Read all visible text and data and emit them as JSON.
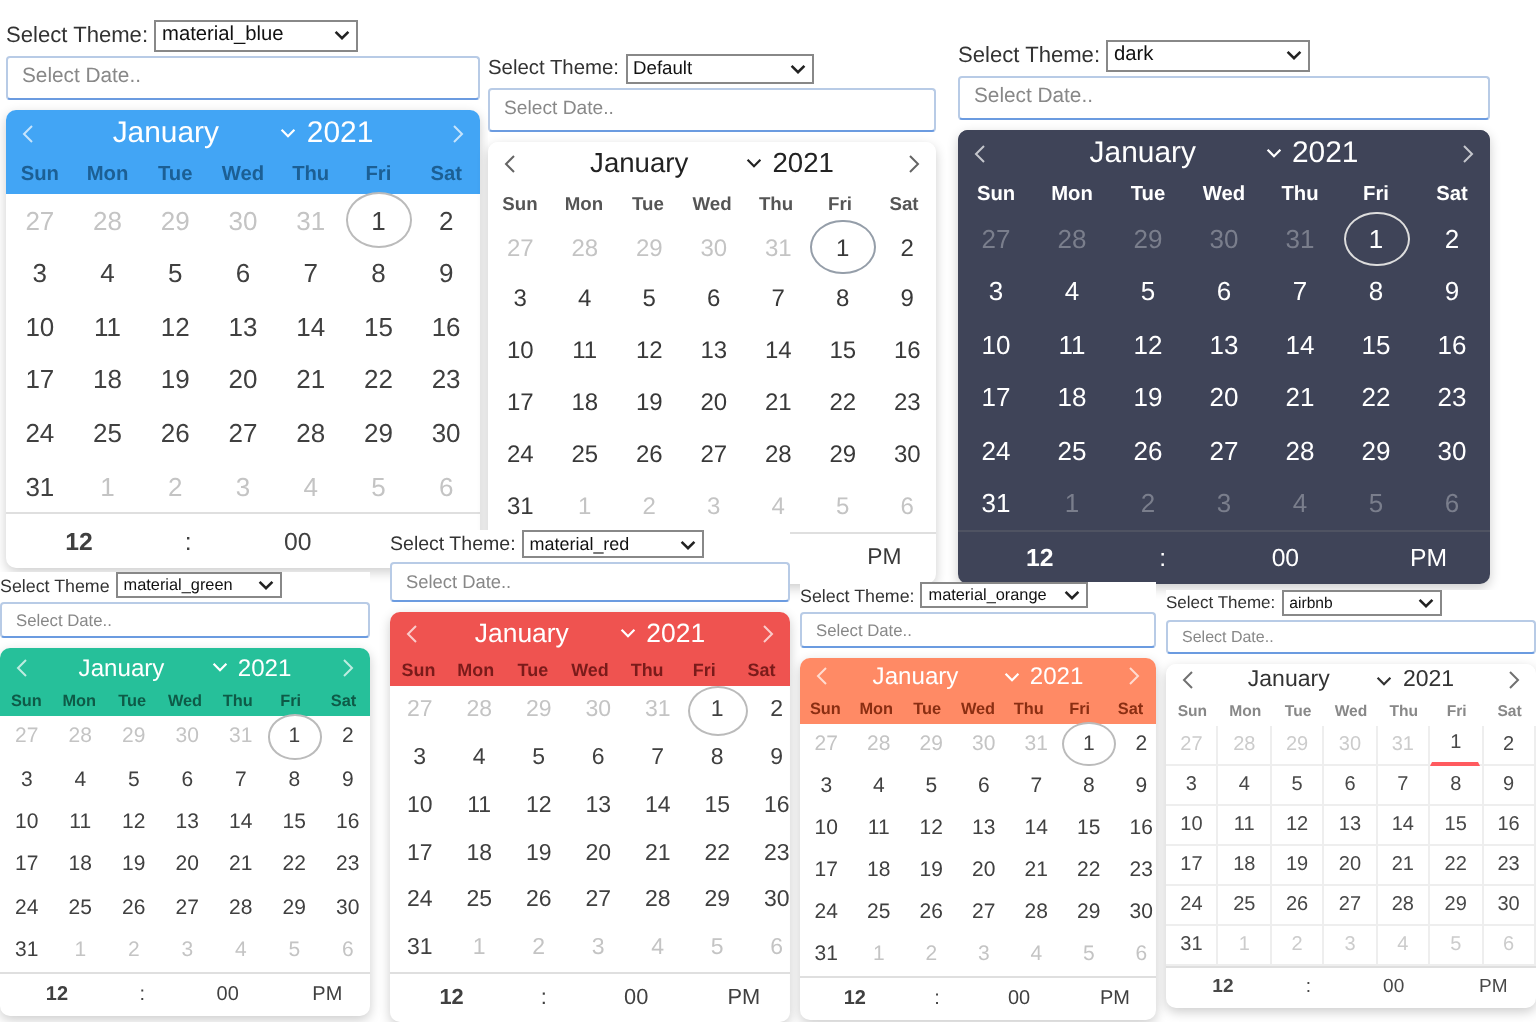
{
  "panels": [
    {
      "kind": "material_blue",
      "label": "Select Theme:",
      "theme": "material_blue",
      "placeholder": "Select Date..",
      "month": "January",
      "year": "2021",
      "weekdays": [
        "Sun",
        "Mon",
        "Tue",
        "Wed",
        "Thu",
        "Fri",
        "Sat"
      ],
      "days": [
        {
          "n": "27",
          "outside": true,
          "today": false
        },
        {
          "n": "28",
          "outside": true,
          "today": false
        },
        {
          "n": "29",
          "outside": true,
          "today": false
        },
        {
          "n": "30",
          "outside": true,
          "today": false
        },
        {
          "n": "31",
          "outside": true,
          "today": false
        },
        {
          "n": "1",
          "outside": false,
          "today": true
        },
        {
          "n": "2",
          "outside": false,
          "today": false
        },
        {
          "n": "3",
          "outside": false,
          "today": false
        },
        {
          "n": "4",
          "outside": false,
          "today": false
        },
        {
          "n": "5",
          "outside": false,
          "today": false
        },
        {
          "n": "6",
          "outside": false,
          "today": false
        },
        {
          "n": "7",
          "outside": false,
          "today": false
        },
        {
          "n": "8",
          "outside": false,
          "today": false
        },
        {
          "n": "9",
          "outside": false,
          "today": false
        },
        {
          "n": "10",
          "outside": false,
          "today": false
        },
        {
          "n": "11",
          "outside": false,
          "today": false
        },
        {
          "n": "12",
          "outside": false,
          "today": false
        },
        {
          "n": "13",
          "outside": false,
          "today": false
        },
        {
          "n": "14",
          "outside": false,
          "today": false
        },
        {
          "n": "15",
          "outside": false,
          "today": false
        },
        {
          "n": "16",
          "outside": false,
          "today": false
        },
        {
          "n": "17",
          "outside": false,
          "today": false
        },
        {
          "n": "18",
          "outside": false,
          "today": false
        },
        {
          "n": "19",
          "outside": false,
          "today": false
        },
        {
          "n": "20",
          "outside": false,
          "today": false
        },
        {
          "n": "21",
          "outside": false,
          "today": false
        },
        {
          "n": "22",
          "outside": false,
          "today": false
        },
        {
          "n": "23",
          "outside": false,
          "today": false
        },
        {
          "n": "24",
          "outside": false,
          "today": false
        },
        {
          "n": "25",
          "outside": false,
          "today": false
        },
        {
          "n": "26",
          "outside": false,
          "today": false
        },
        {
          "n": "27",
          "outside": false,
          "today": false
        },
        {
          "n": "28",
          "outside": false,
          "today": false
        },
        {
          "n": "29",
          "outside": false,
          "today": false
        },
        {
          "n": "30",
          "outside": false,
          "today": false
        },
        {
          "n": "31",
          "outside": false,
          "today": false
        },
        {
          "n": "1",
          "outside": true,
          "today": false
        },
        {
          "n": "2",
          "outside": true,
          "today": false
        },
        {
          "n": "3",
          "outside": true,
          "today": false
        },
        {
          "n": "4",
          "outside": true,
          "today": false
        },
        {
          "n": "5",
          "outside": true,
          "today": false
        },
        {
          "n": "6",
          "outside": true,
          "today": false
        }
      ],
      "time": {
        "hour": "12",
        "separator": ":",
        "minute": "00"
      }
    },
    {
      "kind": "default",
      "label": "Select Theme:",
      "theme": "Default",
      "placeholder": "Select Date..",
      "month": "January",
      "year": "2021",
      "weekdays": [
        "Sun",
        "Mon",
        "Tue",
        "Wed",
        "Thu",
        "Fri",
        "Sat"
      ],
      "days": [
        {
          "n": "27",
          "outside": true,
          "today": false
        },
        {
          "n": "28",
          "outside": true,
          "today": false
        },
        {
          "n": "29",
          "outside": true,
          "today": false
        },
        {
          "n": "30",
          "outside": true,
          "today": false
        },
        {
          "n": "31",
          "outside": true,
          "today": false
        },
        {
          "n": "1",
          "outside": false,
          "today": true
        },
        {
          "n": "2",
          "outside": false,
          "today": false
        },
        {
          "n": "3",
          "outside": false,
          "today": false
        },
        {
          "n": "4",
          "outside": false,
          "today": false
        },
        {
          "n": "5",
          "outside": false,
          "today": false
        },
        {
          "n": "6",
          "outside": false,
          "today": false
        },
        {
          "n": "7",
          "outside": false,
          "today": false
        },
        {
          "n": "8",
          "outside": false,
          "today": false
        },
        {
          "n": "9",
          "outside": false,
          "today": false
        },
        {
          "n": "10",
          "outside": false,
          "today": false
        },
        {
          "n": "11",
          "outside": false,
          "today": false
        },
        {
          "n": "12",
          "outside": false,
          "today": false
        },
        {
          "n": "13",
          "outside": false,
          "today": false
        },
        {
          "n": "14",
          "outside": false,
          "today": false
        },
        {
          "n": "15",
          "outside": false,
          "today": false
        },
        {
          "n": "16",
          "outside": false,
          "today": false
        },
        {
          "n": "17",
          "outside": false,
          "today": false
        },
        {
          "n": "18",
          "outside": false,
          "today": false
        },
        {
          "n": "19",
          "outside": false,
          "today": false
        },
        {
          "n": "20",
          "outside": false,
          "today": false
        },
        {
          "n": "21",
          "outside": false,
          "today": false
        },
        {
          "n": "22",
          "outside": false,
          "today": false
        },
        {
          "n": "23",
          "outside": false,
          "today": false
        },
        {
          "n": "24",
          "outside": false,
          "today": false
        },
        {
          "n": "25",
          "outside": false,
          "today": false
        },
        {
          "n": "26",
          "outside": false,
          "today": false
        },
        {
          "n": "27",
          "outside": false,
          "today": false
        },
        {
          "n": "28",
          "outside": false,
          "today": false
        },
        {
          "n": "29",
          "outside": false,
          "today": false
        },
        {
          "n": "30",
          "outside": false,
          "today": false
        },
        {
          "n": "31",
          "outside": false,
          "today": false
        },
        {
          "n": "1",
          "outside": true,
          "today": false
        },
        {
          "n": "2",
          "outside": true,
          "today": false
        },
        {
          "n": "3",
          "outside": true,
          "today": false
        },
        {
          "n": "4",
          "outside": true,
          "today": false
        },
        {
          "n": "5",
          "outside": true,
          "today": false
        },
        {
          "n": "6",
          "outside": true,
          "today": false
        }
      ],
      "time": {
        "ampm": "PM"
      }
    },
    {
      "kind": "dark",
      "label": "Select Theme:",
      "theme": "dark",
      "placeholder": "Select Date..",
      "month": "January",
      "year": "2021",
      "weekdays": [
        "Sun",
        "Mon",
        "Tue",
        "Wed",
        "Thu",
        "Fri",
        "Sat"
      ],
      "days": [
        {
          "n": "27",
          "outside": true,
          "today": false
        },
        {
          "n": "28",
          "outside": true,
          "today": false
        },
        {
          "n": "29",
          "outside": true,
          "today": false
        },
        {
          "n": "30",
          "outside": true,
          "today": false
        },
        {
          "n": "31",
          "outside": true,
          "today": false
        },
        {
          "n": "1",
          "outside": false,
          "today": true
        },
        {
          "n": "2",
          "outside": false,
          "today": false
        },
        {
          "n": "3",
          "outside": false,
          "today": false
        },
        {
          "n": "4",
          "outside": false,
          "today": false
        },
        {
          "n": "5",
          "outside": false,
          "today": false
        },
        {
          "n": "6",
          "outside": false,
          "today": false
        },
        {
          "n": "7",
          "outside": false,
          "today": false
        },
        {
          "n": "8",
          "outside": false,
          "today": false
        },
        {
          "n": "9",
          "outside": false,
          "today": false
        },
        {
          "n": "10",
          "outside": false,
          "today": false
        },
        {
          "n": "11",
          "outside": false,
          "today": false
        },
        {
          "n": "12",
          "outside": false,
          "today": false
        },
        {
          "n": "13",
          "outside": false,
          "today": false
        },
        {
          "n": "14",
          "outside": false,
          "today": false
        },
        {
          "n": "15",
          "outside": false,
          "today": false
        },
        {
          "n": "16",
          "outside": false,
          "today": false
        },
        {
          "n": "17",
          "outside": false,
          "today": false
        },
        {
          "n": "18",
          "outside": false,
          "today": false
        },
        {
          "n": "19",
          "outside": false,
          "today": false
        },
        {
          "n": "20",
          "outside": false,
          "today": false
        },
        {
          "n": "21",
          "outside": false,
          "today": false
        },
        {
          "n": "22",
          "outside": false,
          "today": false
        },
        {
          "n": "23",
          "outside": false,
          "today": false
        },
        {
          "n": "24",
          "outside": false,
          "today": false
        },
        {
          "n": "25",
          "outside": false,
          "today": false
        },
        {
          "n": "26",
          "outside": false,
          "today": false
        },
        {
          "n": "27",
          "outside": false,
          "today": false
        },
        {
          "n": "28",
          "outside": false,
          "today": false
        },
        {
          "n": "29",
          "outside": false,
          "today": false
        },
        {
          "n": "30",
          "outside": false,
          "today": false
        },
        {
          "n": "31",
          "outside": false,
          "today": false
        },
        {
          "n": "1",
          "outside": true,
          "today": false
        },
        {
          "n": "2",
          "outside": true,
          "today": false
        },
        {
          "n": "3",
          "outside": true,
          "today": false
        },
        {
          "n": "4",
          "outside": true,
          "today": false
        },
        {
          "n": "5",
          "outside": true,
          "today": false
        },
        {
          "n": "6",
          "outside": true,
          "today": false
        }
      ],
      "time": {
        "hour": "12",
        "separator": ":",
        "minute": "00",
        "ampm": "PM"
      }
    },
    {
      "kind": "material_green",
      "label": "Select Theme",
      "theme": "material_green",
      "placeholder": "Select Date..",
      "month": "January",
      "year": "2021",
      "weekdays": [
        "Sun",
        "Mon",
        "Tue",
        "Wed",
        "Thu",
        "Fri",
        "Sat"
      ],
      "days": [
        {
          "n": "27",
          "outside": true,
          "today": false
        },
        {
          "n": "28",
          "outside": true,
          "today": false
        },
        {
          "n": "29",
          "outside": true,
          "today": false
        },
        {
          "n": "30",
          "outside": true,
          "today": false
        },
        {
          "n": "31",
          "outside": true,
          "today": false
        },
        {
          "n": "1",
          "outside": false,
          "today": true
        },
        {
          "n": "2",
          "outside": false,
          "today": false
        },
        {
          "n": "3",
          "outside": false,
          "today": false
        },
        {
          "n": "4",
          "outside": false,
          "today": false
        },
        {
          "n": "5",
          "outside": false,
          "today": false
        },
        {
          "n": "6",
          "outside": false,
          "today": false
        },
        {
          "n": "7",
          "outside": false,
          "today": false
        },
        {
          "n": "8",
          "outside": false,
          "today": false
        },
        {
          "n": "9",
          "outside": false,
          "today": false
        },
        {
          "n": "10",
          "outside": false,
          "today": false
        },
        {
          "n": "11",
          "outside": false,
          "today": false
        },
        {
          "n": "12",
          "outside": false,
          "today": false
        },
        {
          "n": "13",
          "outside": false,
          "today": false
        },
        {
          "n": "14",
          "outside": false,
          "today": false
        },
        {
          "n": "15",
          "outside": false,
          "today": false
        },
        {
          "n": "16",
          "outside": false,
          "today": false
        },
        {
          "n": "17",
          "outside": false,
          "today": false
        },
        {
          "n": "18",
          "outside": false,
          "today": false
        },
        {
          "n": "19",
          "outside": false,
          "today": false
        },
        {
          "n": "20",
          "outside": false,
          "today": false
        },
        {
          "n": "21",
          "outside": false,
          "today": false
        },
        {
          "n": "22",
          "outside": false,
          "today": false
        },
        {
          "n": "23",
          "outside": false,
          "today": false
        },
        {
          "n": "24",
          "outside": false,
          "today": false
        },
        {
          "n": "25",
          "outside": false,
          "today": false
        },
        {
          "n": "26",
          "outside": false,
          "today": false
        },
        {
          "n": "27",
          "outside": false,
          "today": false
        },
        {
          "n": "28",
          "outside": false,
          "today": false
        },
        {
          "n": "29",
          "outside": false,
          "today": false
        },
        {
          "n": "30",
          "outside": false,
          "today": false
        },
        {
          "n": "31",
          "outside": false,
          "today": false
        },
        {
          "n": "1",
          "outside": true,
          "today": false
        },
        {
          "n": "2",
          "outside": true,
          "today": false
        },
        {
          "n": "3",
          "outside": true,
          "today": false
        },
        {
          "n": "4",
          "outside": true,
          "today": false
        },
        {
          "n": "5",
          "outside": true,
          "today": false
        },
        {
          "n": "6",
          "outside": true,
          "today": false
        }
      ],
      "time": {
        "hour": "12",
        "separator": ":",
        "minute": "00",
        "ampm": "PM"
      }
    },
    {
      "kind": "material_red",
      "label": "Select Theme:",
      "theme": "material_red",
      "placeholder": "Select Date..",
      "month": "January",
      "year": "2021",
      "weekdays": [
        "Sun",
        "Mon",
        "Tue",
        "Wed",
        "Thu",
        "Fri",
        "Sat"
      ],
      "days": [
        {
          "n": "27",
          "outside": true,
          "today": false
        },
        {
          "n": "28",
          "outside": true,
          "today": false
        },
        {
          "n": "29",
          "outside": true,
          "today": false
        },
        {
          "n": "30",
          "outside": true,
          "today": false
        },
        {
          "n": "31",
          "outside": true,
          "today": false
        },
        {
          "n": "1",
          "outside": false,
          "today": true
        },
        {
          "n": "2",
          "outside": false,
          "today": false
        },
        {
          "n": "3",
          "outside": false,
          "today": false
        },
        {
          "n": "4",
          "outside": false,
          "today": false
        },
        {
          "n": "5",
          "outside": false,
          "today": false
        },
        {
          "n": "6",
          "outside": false,
          "today": false
        },
        {
          "n": "7",
          "outside": false,
          "today": false
        },
        {
          "n": "8",
          "outside": false,
          "today": false
        },
        {
          "n": "9",
          "outside": false,
          "today": false
        },
        {
          "n": "10",
          "outside": false,
          "today": false
        },
        {
          "n": "11",
          "outside": false,
          "today": false
        },
        {
          "n": "12",
          "outside": false,
          "today": false
        },
        {
          "n": "13",
          "outside": false,
          "today": false
        },
        {
          "n": "14",
          "outside": false,
          "today": false
        },
        {
          "n": "15",
          "outside": false,
          "today": false
        },
        {
          "n": "16",
          "outside": false,
          "today": false
        },
        {
          "n": "17",
          "outside": false,
          "today": false
        },
        {
          "n": "18",
          "outside": false,
          "today": false
        },
        {
          "n": "19",
          "outside": false,
          "today": false
        },
        {
          "n": "20",
          "outside": false,
          "today": false
        },
        {
          "n": "21",
          "outside": false,
          "today": false
        },
        {
          "n": "22",
          "outside": false,
          "today": false
        },
        {
          "n": "23",
          "outside": false,
          "today": false
        },
        {
          "n": "24",
          "outside": false,
          "today": false
        },
        {
          "n": "25",
          "outside": false,
          "today": false
        },
        {
          "n": "26",
          "outside": false,
          "today": false
        },
        {
          "n": "27",
          "outside": false,
          "today": false
        },
        {
          "n": "28",
          "outside": false,
          "today": false
        },
        {
          "n": "29",
          "outside": false,
          "today": false
        },
        {
          "n": "30",
          "outside": false,
          "today": false
        },
        {
          "n": "31",
          "outside": false,
          "today": false
        },
        {
          "n": "1",
          "outside": true,
          "today": false
        },
        {
          "n": "2",
          "outside": true,
          "today": false
        },
        {
          "n": "3",
          "outside": true,
          "today": false
        },
        {
          "n": "4",
          "outside": true,
          "today": false
        },
        {
          "n": "5",
          "outside": true,
          "today": false
        },
        {
          "n": "6",
          "outside": true,
          "today": false
        }
      ],
      "time": {
        "hour": "12",
        "separator": ":",
        "minute": "00",
        "ampm": "PM"
      }
    },
    {
      "kind": "material_orange",
      "label": "Select Theme:",
      "theme": "material_orange",
      "placeholder": "Select Date..",
      "month": "January",
      "year": "2021",
      "weekdays": [
        "Sun",
        "Mon",
        "Tue",
        "Wed",
        "Thu",
        "Fri",
        "Sat"
      ],
      "days": [
        {
          "n": "27",
          "outside": true,
          "today": false
        },
        {
          "n": "28",
          "outside": true,
          "today": false
        },
        {
          "n": "29",
          "outside": true,
          "today": false
        },
        {
          "n": "30",
          "outside": true,
          "today": false
        },
        {
          "n": "31",
          "outside": true,
          "today": false
        },
        {
          "n": "1",
          "outside": false,
          "today": true
        },
        {
          "n": "2",
          "outside": false,
          "today": false
        },
        {
          "n": "3",
          "outside": false,
          "today": false
        },
        {
          "n": "4",
          "outside": false,
          "today": false
        },
        {
          "n": "5",
          "outside": false,
          "today": false
        },
        {
          "n": "6",
          "outside": false,
          "today": false
        },
        {
          "n": "7",
          "outside": false,
          "today": false
        },
        {
          "n": "8",
          "outside": false,
          "today": false
        },
        {
          "n": "9",
          "outside": false,
          "today": false
        },
        {
          "n": "10",
          "outside": false,
          "today": false
        },
        {
          "n": "11",
          "outside": false,
          "today": false
        },
        {
          "n": "12",
          "outside": false,
          "today": false
        },
        {
          "n": "13",
          "outside": false,
          "today": false
        },
        {
          "n": "14",
          "outside": false,
          "today": false
        },
        {
          "n": "15",
          "outside": false,
          "today": false
        },
        {
          "n": "16",
          "outside": false,
          "today": false
        },
        {
          "n": "17",
          "outside": false,
          "today": false
        },
        {
          "n": "18",
          "outside": false,
          "today": false
        },
        {
          "n": "19",
          "outside": false,
          "today": false
        },
        {
          "n": "20",
          "outside": false,
          "today": false
        },
        {
          "n": "21",
          "outside": false,
          "today": false
        },
        {
          "n": "22",
          "outside": false,
          "today": false
        },
        {
          "n": "23",
          "outside": false,
          "today": false
        },
        {
          "n": "24",
          "outside": false,
          "today": false
        },
        {
          "n": "25",
          "outside": false,
          "today": false
        },
        {
          "n": "26",
          "outside": false,
          "today": false
        },
        {
          "n": "27",
          "outside": false,
          "today": false
        },
        {
          "n": "28",
          "outside": false,
          "today": false
        },
        {
          "n": "29",
          "outside": false,
          "today": false
        },
        {
          "n": "30",
          "outside": false,
          "today": false
        },
        {
          "n": "31",
          "outside": false,
          "today": false
        },
        {
          "n": "1",
          "outside": true,
          "today": false
        },
        {
          "n": "2",
          "outside": true,
          "today": false
        },
        {
          "n": "3",
          "outside": true,
          "today": false
        },
        {
          "n": "4",
          "outside": true,
          "today": false
        },
        {
          "n": "5",
          "outside": true,
          "today": false
        },
        {
          "n": "6",
          "outside": true,
          "today": false
        }
      ],
      "time": {
        "hour": "12",
        "separator": ":",
        "minute": "00",
        "ampm": "PM"
      }
    },
    {
      "kind": "airbnb",
      "label": "Select Theme:",
      "theme": "airbnb",
      "placeholder": "Select Date..",
      "month": "January",
      "year": "2021",
      "weekdays": [
        "Sun",
        "Mon",
        "Tue",
        "Wed",
        "Thu",
        "Fri",
        "Sat"
      ],
      "days": [
        {
          "n": "27",
          "outside": true,
          "today": false
        },
        {
          "n": "28",
          "outside": true,
          "today": false
        },
        {
          "n": "29",
          "outside": true,
          "today": false
        },
        {
          "n": "30",
          "outside": true,
          "today": false
        },
        {
          "n": "31",
          "outside": true,
          "today": false
        },
        {
          "n": "1",
          "outside": false,
          "today": true
        },
        {
          "n": "2",
          "outside": false,
          "today": false
        },
        {
          "n": "3",
          "outside": false,
          "today": false
        },
        {
          "n": "4",
          "outside": false,
          "today": false
        },
        {
          "n": "5",
          "outside": false,
          "today": false
        },
        {
          "n": "6",
          "outside": false,
          "today": false
        },
        {
          "n": "7",
          "outside": false,
          "today": false
        },
        {
          "n": "8",
          "outside": false,
          "today": false
        },
        {
          "n": "9",
          "outside": false,
          "today": false
        },
        {
          "n": "10",
          "outside": false,
          "today": false
        },
        {
          "n": "11",
          "outside": false,
          "today": false
        },
        {
          "n": "12",
          "outside": false,
          "today": false
        },
        {
          "n": "13",
          "outside": false,
          "today": false
        },
        {
          "n": "14",
          "outside": false,
          "today": false
        },
        {
          "n": "15",
          "outside": false,
          "today": false
        },
        {
          "n": "16",
          "outside": false,
          "today": false
        },
        {
          "n": "17",
          "outside": false,
          "today": false
        },
        {
          "n": "18",
          "outside": false,
          "today": false
        },
        {
          "n": "19",
          "outside": false,
          "today": false
        },
        {
          "n": "20",
          "outside": false,
          "today": false
        },
        {
          "n": "21",
          "outside": false,
          "today": false
        },
        {
          "n": "22",
          "outside": false,
          "today": false
        },
        {
          "n": "23",
          "outside": false,
          "today": false
        },
        {
          "n": "24",
          "outside": false,
          "today": false
        },
        {
          "n": "25",
          "outside": false,
          "today": false
        },
        {
          "n": "26",
          "outside": false,
          "today": false
        },
        {
          "n": "27",
          "outside": false,
          "today": false
        },
        {
          "n": "28",
          "outside": false,
          "today": false
        },
        {
          "n": "29",
          "outside": false,
          "today": false
        },
        {
          "n": "30",
          "outside": false,
          "today": false
        },
        {
          "n": "31",
          "outside": false,
          "today": false
        },
        {
          "n": "1",
          "outside": true,
          "today": false
        },
        {
          "n": "2",
          "outside": true,
          "today": false
        },
        {
          "n": "3",
          "outside": true,
          "today": false
        },
        {
          "n": "4",
          "outside": true,
          "today": false
        },
        {
          "n": "5",
          "outside": true,
          "today": false
        },
        {
          "n": "6",
          "outside": true,
          "today": false
        }
      ],
      "time": {
        "hour": "12",
        "separator": ":",
        "minute": "00",
        "ampm": "PM"
      }
    }
  ]
}
